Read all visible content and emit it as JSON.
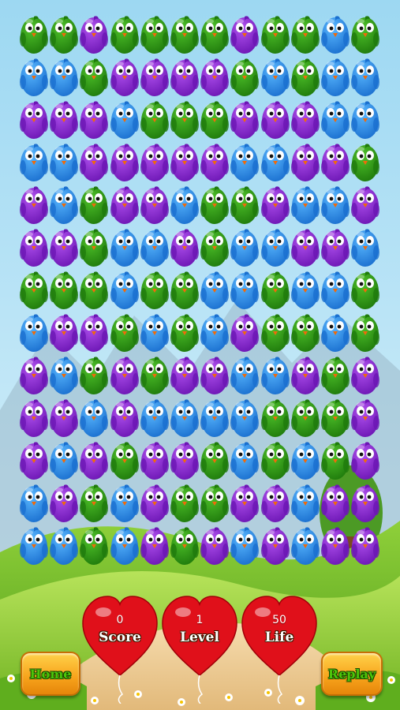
{
  "colors": {
    "green": "#2f9a16",
    "blue": "#2d8fe6",
    "purple": "#8a2bd6",
    "heart": "#e0101a",
    "button": "#f7a21b",
    "button_text": "#4dc40a"
  },
  "board": {
    "columns": 12,
    "rows": 13,
    "cells": [
      [
        "green",
        "green",
        "purple",
        "green",
        "green",
        "green",
        "green",
        "purple",
        "green",
        "green",
        "blue",
        "green"
      ],
      [
        "blue",
        "blue",
        "green",
        "purple",
        "purple",
        "purple",
        "purple",
        "green",
        "blue",
        "green",
        "blue",
        "blue"
      ],
      [
        "purple",
        "purple",
        "purple",
        "blue",
        "green",
        "green",
        "green",
        "purple",
        "purple",
        "purple",
        "blue",
        "blue"
      ],
      [
        "blue",
        "blue",
        "purple",
        "purple",
        "purple",
        "purple",
        "purple",
        "blue",
        "blue",
        "purple",
        "purple",
        "green"
      ],
      [
        "purple",
        "blue",
        "green",
        "purple",
        "purple",
        "blue",
        "green",
        "green",
        "purple",
        "blue",
        "blue",
        "purple"
      ],
      [
        "purple",
        "purple",
        "green",
        "blue",
        "blue",
        "purple",
        "green",
        "blue",
        "blue",
        "purple",
        "purple",
        "blue"
      ],
      [
        "green",
        "green",
        "green",
        "blue",
        "green",
        "green",
        "blue",
        "blue",
        "green",
        "blue",
        "blue",
        "green"
      ],
      [
        "blue",
        "purple",
        "purple",
        "green",
        "blue",
        "green",
        "blue",
        "purple",
        "green",
        "green",
        "blue",
        "green"
      ],
      [
        "purple",
        "blue",
        "green",
        "purple",
        "green",
        "purple",
        "purple",
        "blue",
        "blue",
        "purple",
        "green",
        "purple"
      ],
      [
        "purple",
        "purple",
        "blue",
        "purple",
        "blue",
        "blue",
        "blue",
        "blue",
        "green",
        "green",
        "green",
        "purple"
      ],
      [
        "purple",
        "blue",
        "purple",
        "green",
        "purple",
        "purple",
        "green",
        "blue",
        "green",
        "blue",
        "green",
        "purple"
      ],
      [
        "blue",
        "purple",
        "green",
        "blue",
        "purple",
        "green",
        "green",
        "purple",
        "purple",
        "blue",
        "purple",
        "purple"
      ],
      [
        "blue",
        "blue",
        "green",
        "blue",
        "purple",
        "green",
        "purple",
        "blue",
        "purple",
        "blue",
        "purple",
        "purple"
      ]
    ]
  },
  "stats": {
    "score": {
      "label": "Score",
      "value": "0"
    },
    "level": {
      "label": "Level",
      "value": "1"
    },
    "life": {
      "label": "Life",
      "value": "50"
    }
  },
  "buttons": {
    "home": "Home",
    "replay": "Replay"
  }
}
